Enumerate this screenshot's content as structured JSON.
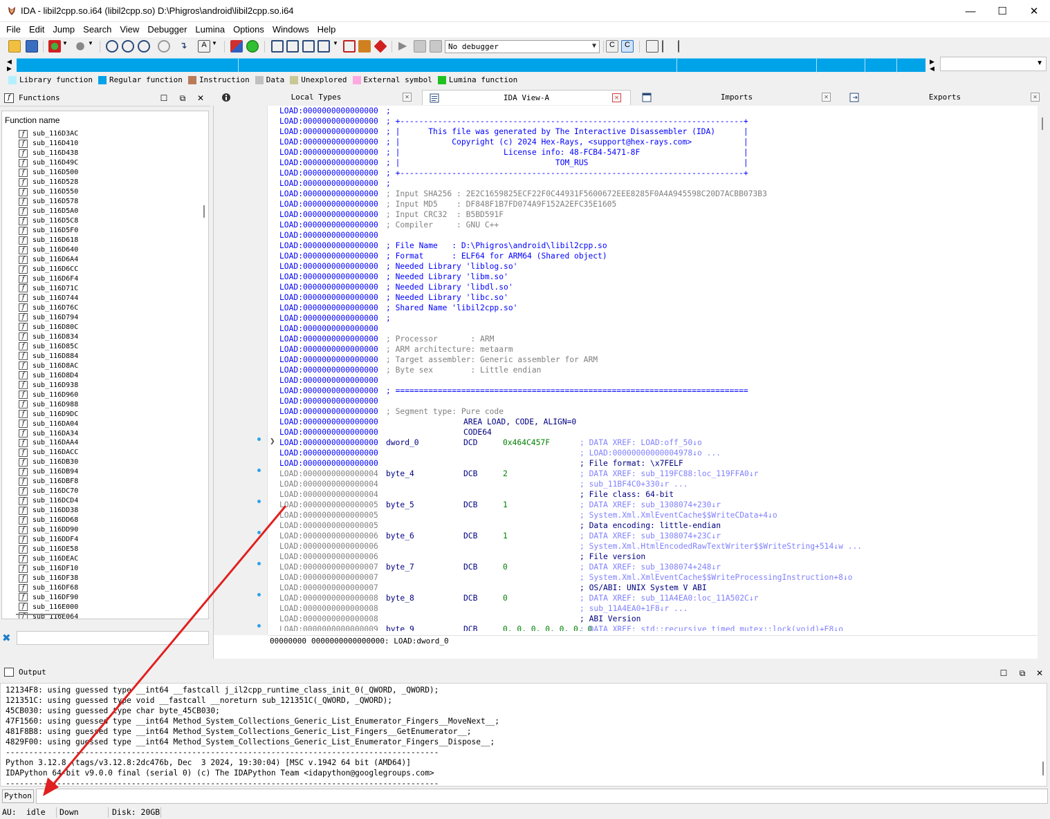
{
  "window": {
    "title": "IDA - libil2cpp.so.i64 (libil2cpp.so) D:\\Phigros\\android\\libil2cpp.so.i64",
    "minimize": "—",
    "maximize": "☐",
    "close": "✕"
  },
  "menu": [
    "File",
    "Edit",
    "Jump",
    "Search",
    "View",
    "Debugger",
    "Lumina",
    "Options",
    "Windows",
    "Help"
  ],
  "toolbar": {
    "debugger_value": "No debugger"
  },
  "legend": [
    {
      "label": "Library function",
      "color": "#b3f0ff"
    },
    {
      "label": "Regular function",
      "color": "#00a2e8"
    },
    {
      "label": "Instruction",
      "color": "#b97a57"
    },
    {
      "label": "Data",
      "color": "#c0c0c0"
    },
    {
      "label": "Unexplored",
      "color": "#c8c896"
    },
    {
      "label": "External symbol",
      "color": "#ffa8e0"
    },
    {
      "label": "Lumina function",
      "color": "#22c022"
    }
  ],
  "functions": {
    "title": "Functions",
    "column_header": "Function name",
    "items": [
      "sub_116D3AC",
      "sub_116D410",
      "sub_116D438",
      "sub_116D49C",
      "sub_116D500",
      "sub_116D528",
      "sub_116D550",
      "sub_116D578",
      "sub_116D5A0",
      "sub_116D5C8",
      "sub_116D5F0",
      "sub_116D618",
      "sub_116D640",
      "sub_116D6A4",
      "sub_116D6CC",
      "sub_116D6F4",
      "sub_116D71C",
      "sub_116D744",
      "sub_116D76C",
      "sub_116D794",
      "sub_116D80C",
      "sub_116D834",
      "sub_116D85C",
      "sub_116D884",
      "sub_116D8AC",
      "sub_116D8D4",
      "sub_116D938",
      "sub_116D960",
      "sub_116D988",
      "sub_116D9DC",
      "sub_116DA04",
      "sub_116DA34",
      "sub_116DAA4",
      "sub_116DACC",
      "sub_116DB30",
      "sub_116DB94",
      "sub_116DBF8",
      "sub_116DC70",
      "sub_116DCD4",
      "sub_116DD38",
      "sub_116DD68",
      "sub_116DD90",
      "sub_116DDF4",
      "sub_116DE58",
      "sub_116DEAC",
      "sub_116DF10",
      "sub_116DF38",
      "sub_116DF68",
      "sub_116DF90",
      "sub_116E000",
      "sub_116E064"
    ]
  },
  "tabs": [
    {
      "label": "Local Types"
    },
    {
      "label": "IDA View-A"
    },
    {
      "label": "Imports"
    },
    {
      "label": "Exports"
    }
  ],
  "listing": [
    {
      "a": "LOAD:0000000000000000",
      "k": "seg",
      "t": ";",
      "c": "c-blue"
    },
    {
      "a": "LOAD:0000000000000000",
      "k": "seg",
      "t": "; +-------------------------------------------------------------------------+",
      "c": "c-blue"
    },
    {
      "a": "LOAD:0000000000000000",
      "k": "seg",
      "t": "; |      This file was generated by The Interactive Disassembler (IDA)      |",
      "c": "c-blue"
    },
    {
      "a": "LOAD:0000000000000000",
      "k": "seg",
      "t": "; |           Copyright (c) 2024 Hex-Rays, <support@hex-rays.com>           |",
      "c": "c-blue"
    },
    {
      "a": "LOAD:0000000000000000",
      "k": "seg",
      "t": "; |                      License info: 48-FCB4-5471-8F                      |",
      "c": "c-blue"
    },
    {
      "a": "LOAD:0000000000000000",
      "k": "seg",
      "t": "; |                                 TOM_RUS                                 |",
      "c": "c-blue"
    },
    {
      "a": "LOAD:0000000000000000",
      "k": "seg",
      "t": "; +-------------------------------------------------------------------------+",
      "c": "c-blue"
    },
    {
      "a": "LOAD:0000000000000000",
      "k": "seg",
      "t": ";",
      "c": "c-blue"
    },
    {
      "a": "LOAD:0000000000000000",
      "k": "seg",
      "t": "; Input SHA256 : 2E2C1659825ECF22F0C44931F5600672EEE8285F0A4A945598C20D7ACBB073B3",
      "c": "c-gray"
    },
    {
      "a": "LOAD:0000000000000000",
      "k": "seg",
      "t": "; Input MD5    : DF848F1B7FD074A9F152A2EFC35E1605",
      "c": "c-gray"
    },
    {
      "a": "LOAD:0000000000000000",
      "k": "seg",
      "t": "; Input CRC32  : B5BD591F",
      "c": "c-gray"
    },
    {
      "a": "LOAD:0000000000000000",
      "k": "seg",
      "t": "; Compiler     : GNU C++",
      "c": "c-gray"
    },
    {
      "a": "LOAD:0000000000000000",
      "k": "seg",
      "t": "",
      "c": "c-blue"
    },
    {
      "a": "LOAD:0000000000000000",
      "k": "seg",
      "t": "; File Name   : D:\\Phigros\\android\\libil2cpp.so",
      "c": "c-blue"
    },
    {
      "a": "LOAD:0000000000000000",
      "k": "seg",
      "t": "; Format      : ELF64 for ARM64 (Shared object)",
      "c": "c-blue"
    },
    {
      "a": "LOAD:0000000000000000",
      "k": "seg",
      "t": "; Needed Library 'liblog.so'",
      "c": "c-blue"
    },
    {
      "a": "LOAD:0000000000000000",
      "k": "seg",
      "t": "; Needed Library 'libm.so'",
      "c": "c-blue"
    },
    {
      "a": "LOAD:0000000000000000",
      "k": "seg",
      "t": "; Needed Library 'libdl.so'",
      "c": "c-blue"
    },
    {
      "a": "LOAD:0000000000000000",
      "k": "seg",
      "t": "; Needed Library 'libc.so'",
      "c": "c-blue"
    },
    {
      "a": "LOAD:0000000000000000",
      "k": "seg",
      "t": "; Shared Name 'libil2cpp.so'",
      "c": "c-blue"
    },
    {
      "a": "LOAD:0000000000000000",
      "k": "seg",
      "t": ";",
      "c": "c-blue"
    },
    {
      "a": "LOAD:0000000000000000",
      "k": "seg",
      "t": "",
      "c": "c-blue"
    },
    {
      "a": "LOAD:0000000000000000",
      "k": "seg",
      "t": "; Processor       : ARM",
      "c": "c-gray"
    },
    {
      "a": "LOAD:0000000000000000",
      "k": "seg",
      "t": "; ARM architecture: metaarm",
      "c": "c-gray"
    },
    {
      "a": "LOAD:0000000000000000",
      "k": "seg",
      "t": "; Target assembler: Generic assembler for ARM",
      "c": "c-gray"
    },
    {
      "a": "LOAD:0000000000000000",
      "k": "seg",
      "t": "; Byte sex        : Little endian",
      "c": "c-gray"
    },
    {
      "a": "LOAD:0000000000000000",
      "k": "seg",
      "t": "",
      "c": "c-blue"
    },
    {
      "a": "LOAD:0000000000000000",
      "k": "seg",
      "t": "; ===========================================================================",
      "c": "c-blue"
    },
    {
      "a": "LOAD:0000000000000000",
      "k": "seg",
      "t": "",
      "c": "c-blue"
    },
    {
      "a": "LOAD:0000000000000000",
      "k": "seg",
      "t": "; Segment type: Pure code",
      "c": "c-gray"
    },
    {
      "a": "LOAD:0000000000000000",
      "k": "code",
      "m": "AREA LOAD, CODE, ALIGN=0"
    },
    {
      "a": "LOAD:0000000000000000",
      "k": "code",
      "m": "CODE64"
    },
    {
      "a": "LOAD:0000000000000000",
      "k": "data",
      "seg": true,
      "l": "dword_0",
      "m": "DCD",
      "o": "0x464C457F",
      "oc": "c-green",
      "r": "; DATA XREF: LOAD:off_50↓o",
      "rc": "c-xref"
    },
    {
      "a": "LOAD:0000000000000000",
      "k": "data",
      "seg": true,
      "r": "; LOAD:00000000000004978↓o ...",
      "rc": "c-xref"
    },
    {
      "a": "LOAD:0000000000000000",
      "k": "data",
      "seg": true,
      "r": "; File format: \\x7FELF",
      "rc": "c-navy"
    },
    {
      "a": "LOAD:0000000000000004",
      "k": "data",
      "l": "byte_4",
      "m": "DCB",
      "o": "2",
      "oc": "c-green",
      "r": "; DATA XREF: sub_119FC88:loc_119FFA0↓r",
      "rc": "c-xref"
    },
    {
      "a": "LOAD:0000000000000004",
      "k": "data",
      "r": "; sub_11BF4C0+330↓r ...",
      "rc": "c-xref"
    },
    {
      "a": "LOAD:0000000000000004",
      "k": "data",
      "r": "; File class: 64-bit",
      "rc": "c-navy"
    },
    {
      "a": "LOAD:0000000000000005",
      "k": "data",
      "l": "byte_5",
      "m": "DCB",
      "o": "1",
      "oc": "c-green",
      "r": "; DATA XREF: sub_1308074+230↓r",
      "rc": "c-xref"
    },
    {
      "a": "LOAD:0000000000000005",
      "k": "data",
      "r": "; System.Xml.XmlEventCache$$WriteCData+4↓o",
      "rc": "c-xref"
    },
    {
      "a": "LOAD:0000000000000005",
      "k": "data",
      "r": "; Data encoding: little-endian",
      "rc": "c-navy"
    },
    {
      "a": "LOAD:0000000000000006",
      "k": "data",
      "l": "byte_6",
      "m": "DCB",
      "o": "1",
      "oc": "c-green",
      "r": "; DATA XREF: sub_1308074+23C↓r",
      "rc": "c-xref"
    },
    {
      "a": "LOAD:0000000000000006",
      "k": "data",
      "r": "; System.Xml.HtmlEncodedRawTextWriter$$WriteString+514↓w ...",
      "rc": "c-xref"
    },
    {
      "a": "LOAD:0000000000000006",
      "k": "data",
      "r": "; File version",
      "rc": "c-navy"
    },
    {
      "a": "LOAD:0000000000000007",
      "k": "data",
      "l": "byte_7",
      "m": "DCB",
      "o": "0",
      "oc": "c-green",
      "r": "; DATA XREF: sub_1308074+248↓r",
      "rc": "c-xref"
    },
    {
      "a": "LOAD:0000000000000007",
      "k": "data",
      "r": "; System.Xml.XmlEventCache$$WriteProcessingInstruction+8↓o",
      "rc": "c-xref"
    },
    {
      "a": "LOAD:0000000000000007",
      "k": "data",
      "r": "; OS/ABI: UNIX System V ABI",
      "rc": "c-navy"
    },
    {
      "a": "LOAD:0000000000000008",
      "k": "data",
      "l": "byte_8",
      "m": "DCB",
      "o": "0",
      "oc": "c-green",
      "r": "; DATA XREF: sub_11A4EA0:loc_11A502C↓r",
      "rc": "c-xref"
    },
    {
      "a": "LOAD:0000000000000008",
      "k": "data",
      "r": "; sub_11A4EA0+1F8↓r ...",
      "rc": "c-xref"
    },
    {
      "a": "LOAD:0000000000000008",
      "k": "data",
      "r": "; ABI Version",
      "rc": "c-navy"
    },
    {
      "a": "LOAD:0000000000000009",
      "k": "data",
      "l": "byte_9",
      "m": "DCB",
      "o": "0, 0, 0, 0, 0, 0, 0",
      "oc": "c-green",
      "r": "; DATA XREF: std::recursive_timed_mutex::lock(void)+E8↓o",
      "rc": "c-xref"
    }
  ],
  "ida_status": {
    "offset": "00000000",
    "location": "0000000000000000: LOAD:dword_0"
  },
  "output": {
    "title": "Output",
    "lines": [
      "12134F8: using guessed type __int64 __fastcall j_il2cpp_runtime_class_init_0(_QWORD, _QWORD);",
      "121351C: using guessed type void __fastcall __noreturn sub_121351C(_QWORD, _QWORD);",
      "45CB030: using guessed type char byte_45CB030;",
      "47F1560: using guessed type __int64 Method_System_Collections_Generic_List_Enumerator_Fingers__MoveNext__;",
      "481F8B8: using guessed type __int64 Method_System_Collections_Generic_List_Fingers__GetEnumerator__;",
      "4829F00: using guessed type __int64 Method_System_Collections_Generic_List_Enumerator_Fingers__Dispose__;",
      "---------------------------------------------------------------------------------------------",
      "Python 3.12.8 (tags/v3.12.8:2dc476b, Dec  3 2024, 19:30:04) [MSC v.1942 64 bit (AMD64)]",
      "IDAPython 64-bit v9.0.0 final (serial 0) (c) The IDAPython Team <idapython@googlegroups.com>",
      "---------------------------------------------------------------------------------------------"
    ]
  },
  "python": {
    "button": "Python"
  },
  "statusbar": {
    "au_label": "AU:",
    "au_value": "idle",
    "direction": "Down",
    "disk": "Disk: 20GB"
  },
  "colors": {
    "nav_regular": "#00a2e8",
    "annotation_arrow": "#e02020"
  }
}
